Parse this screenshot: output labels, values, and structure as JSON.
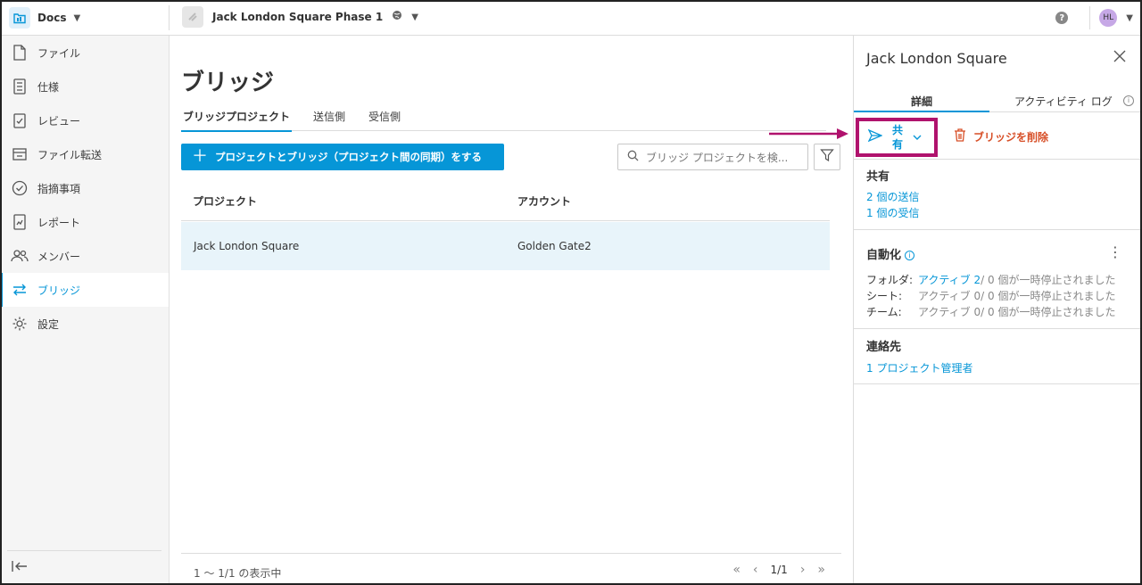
{
  "topbar": {
    "app_name": "Docs",
    "project_name": "Jack London Square Phase 1",
    "help": "?",
    "user_initials": "HL"
  },
  "sidebar": {
    "items": [
      {
        "label": "ファイル",
        "icon": "file-icon",
        "active": false
      },
      {
        "label": "仕様",
        "icon": "spec-list-icon",
        "active": false
      },
      {
        "label": "レビュー",
        "icon": "review-clipboard-icon",
        "active": false
      },
      {
        "label": "ファイル転送",
        "icon": "transmittal-tray-icon",
        "active": false
      },
      {
        "label": "指摘事項",
        "icon": "issue-check-icon",
        "active": false
      },
      {
        "label": "レポート",
        "icon": "report-icon",
        "active": false
      },
      {
        "label": "メンバー",
        "icon": "members-icon",
        "active": false
      },
      {
        "label": "ブリッジ",
        "icon": "bridge-arrows-icon",
        "active": true
      },
      {
        "label": "設定",
        "icon": "gear-icon",
        "active": false
      }
    ]
  },
  "main": {
    "title": "ブリッジ",
    "tabs": [
      "ブリッジプロジェクト",
      "送信側",
      "受信側"
    ],
    "add_button": "プロジェクトとブリッジ（プロジェクト間の同期）をする",
    "search_placeholder": "ブリッジ プロジェクトを検...",
    "table": {
      "headers": [
        "プロジェクト",
        "アカウント"
      ],
      "rows": [
        [
          "Jack London Square",
          "Golden Gate2"
        ]
      ]
    },
    "footer": {
      "count": "1 〜 1/1 の表示中",
      "page": "1/1"
    }
  },
  "panel": {
    "title": "Jack London Square",
    "tabs": [
      "詳細",
      "アクティビティ ログ"
    ],
    "share_button": "共有",
    "delete_button": "ブリッジを削除",
    "share_section": {
      "title": "共有",
      "sent": "2 個の送信",
      "received": "1 個の受信"
    },
    "automation": {
      "title": "自動化",
      "rows": [
        {
          "key": "フォルダ:",
          "active": "アクティブ 2",
          "rest": " / 0 個が一時停止されました",
          "highlight": true
        },
        {
          "key": "シート:",
          "active": "アクティブ 0",
          "rest": " / 0 個が一時停止されました",
          "highlight": false
        },
        {
          "key": "チーム:",
          "active": "アクティブ 0",
          "rest": " / 0 個が一時停止されました",
          "highlight": false
        }
      ]
    },
    "contacts": {
      "title": "連絡先",
      "admin": "1 プロジェクト管理者"
    }
  },
  "colors": {
    "accent": "#0696d7",
    "highlight_box": "#b0126d",
    "delete": "#d74e26",
    "row_selected": "#e8f4fa"
  }
}
